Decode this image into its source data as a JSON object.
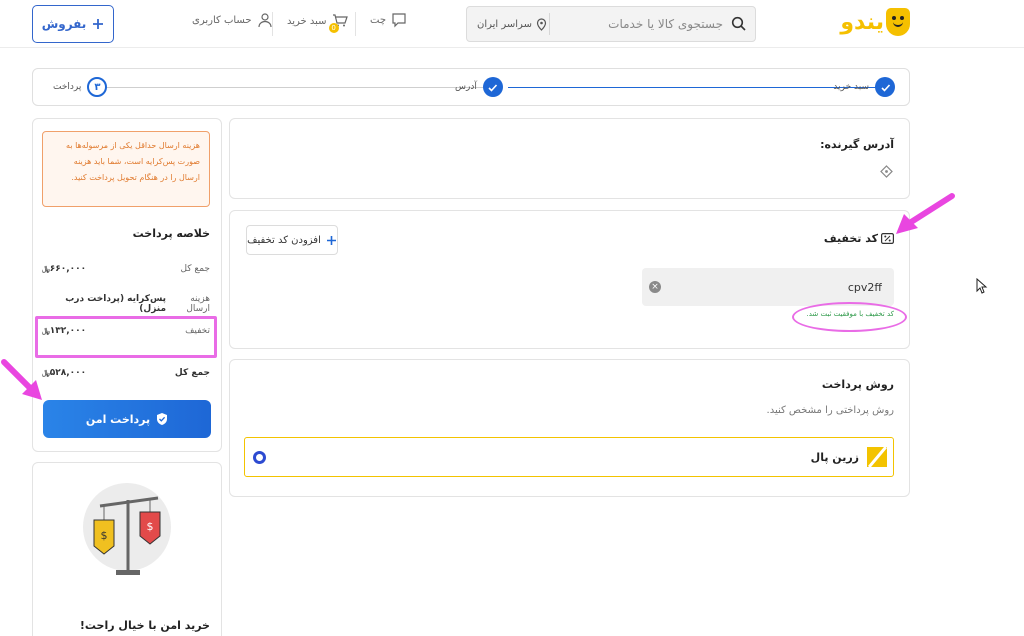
{
  "header": {
    "logo_text": "یندو",
    "search_placeholder": "جستجوی کالا یا خدمات",
    "location": "سراسر ایران",
    "chat": "چت",
    "cart": "سبد خرید",
    "cart_badge": "0",
    "account": "حساب کاربری",
    "sell": "بفروش"
  },
  "stepper": {
    "steps": [
      {
        "label": "سبد خرید",
        "state": "done"
      },
      {
        "label": "آدرس",
        "state": "done"
      },
      {
        "label": "پرداخت",
        "number": "۳",
        "state": "current"
      }
    ]
  },
  "address": {
    "title": "آدرس گیرنده:"
  },
  "discount": {
    "title": "کد تخفیف",
    "add_button": "افزودن کد تخفیف",
    "code_value": "cpv2ff",
    "success_message": "کد تخفیف با موفقیت ثبت شد."
  },
  "payment_method": {
    "title": "روش پرداخت",
    "hint": "روش پرداختی را مشخص کنید.",
    "option": "زرین پال"
  },
  "summary": {
    "warning": "هزینه ارسال حداقل یکی از مرسوله‌ها به صورت پس‌کرایه است، شما باید هزینه ارسال را در هنگام تحویل پرداخت کنید.",
    "title": "خلاصه پرداخت",
    "subtotal_label": "جمع کل",
    "subtotal_value": "۶۶۰,۰۰۰",
    "shipping_label": "هزینه ارسال",
    "shipping_value": "پس‌کرایه (پرداخت درب منزل)",
    "discount_label": "تخفیف",
    "discount_value": "۱۳۲,۰۰۰",
    "total_label": "جمع کل",
    "total_value": "۵۲۸,۰۰۰",
    "pay_button": "پرداخت امن",
    "currency_symbol": "﷼"
  },
  "promo": {
    "title": "خرید امن با خیال راحت!"
  },
  "colors": {
    "primary": "#1e67d6",
    "brand_yellow": "#f5c000",
    "annotation_magenta": "#e96ce6",
    "warning_orange": "#e07a2e",
    "success_green": "#2f9a4a"
  }
}
